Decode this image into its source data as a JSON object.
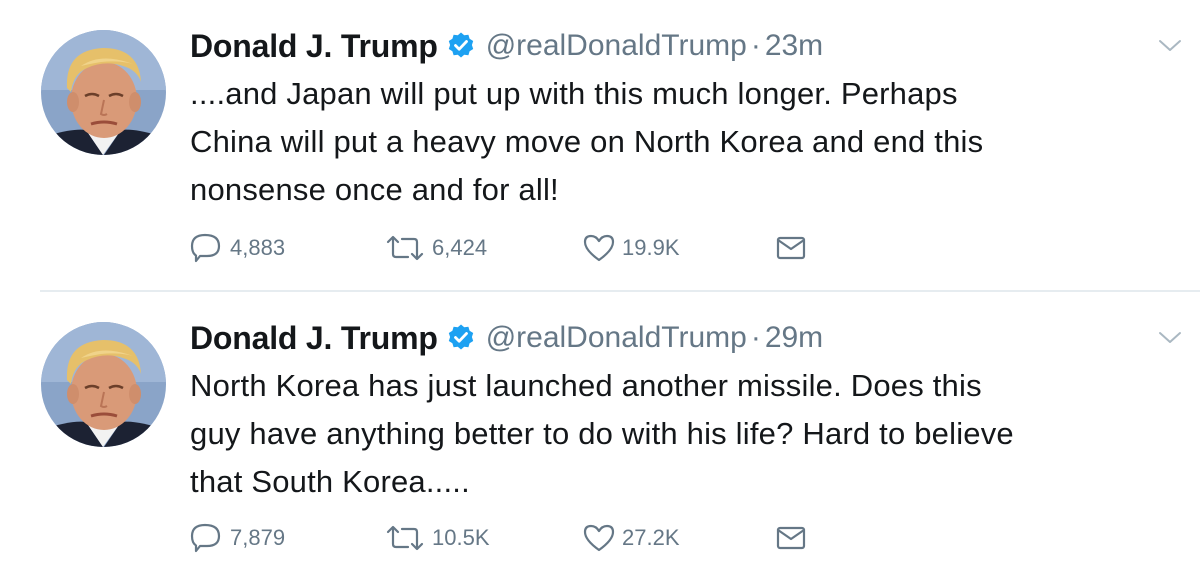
{
  "tweets": [
    {
      "author_name": "Donald J. Trump",
      "handle": "@realDonaldTrump",
      "separator": "·",
      "time": "23m",
      "lines": [
        "....and Japan will put up with this much longer. Perhaps",
        "China will put a heavy move on North Korea and end this",
        "nonsense once and for all!"
      ],
      "replies": "4,883",
      "retweets": "6,424",
      "likes": "19.9K"
    },
    {
      "author_name": "Donald J. Trump",
      "handle": "@realDonaldTrump",
      "separator": "·",
      "time": "29m",
      "lines": [
        "North Korea has just launched another missile. Does this",
        "guy have anything better to do with his life? Hard to believe",
        "that South Korea....."
      ],
      "replies": "7,879",
      "retweets": "10.5K",
      "likes": "27.2K"
    }
  ],
  "icons": {
    "verified": "verified-badge-icon",
    "caret": "chevron-down-icon",
    "reply": "reply-icon",
    "retweet": "retweet-icon",
    "like": "heart-icon",
    "dm": "direct-message-icon"
  },
  "colors": {
    "verified_blue": "#1da1f2",
    "text": "#14171a",
    "secondary": "#657786",
    "divider": "#e6ecf0"
  }
}
